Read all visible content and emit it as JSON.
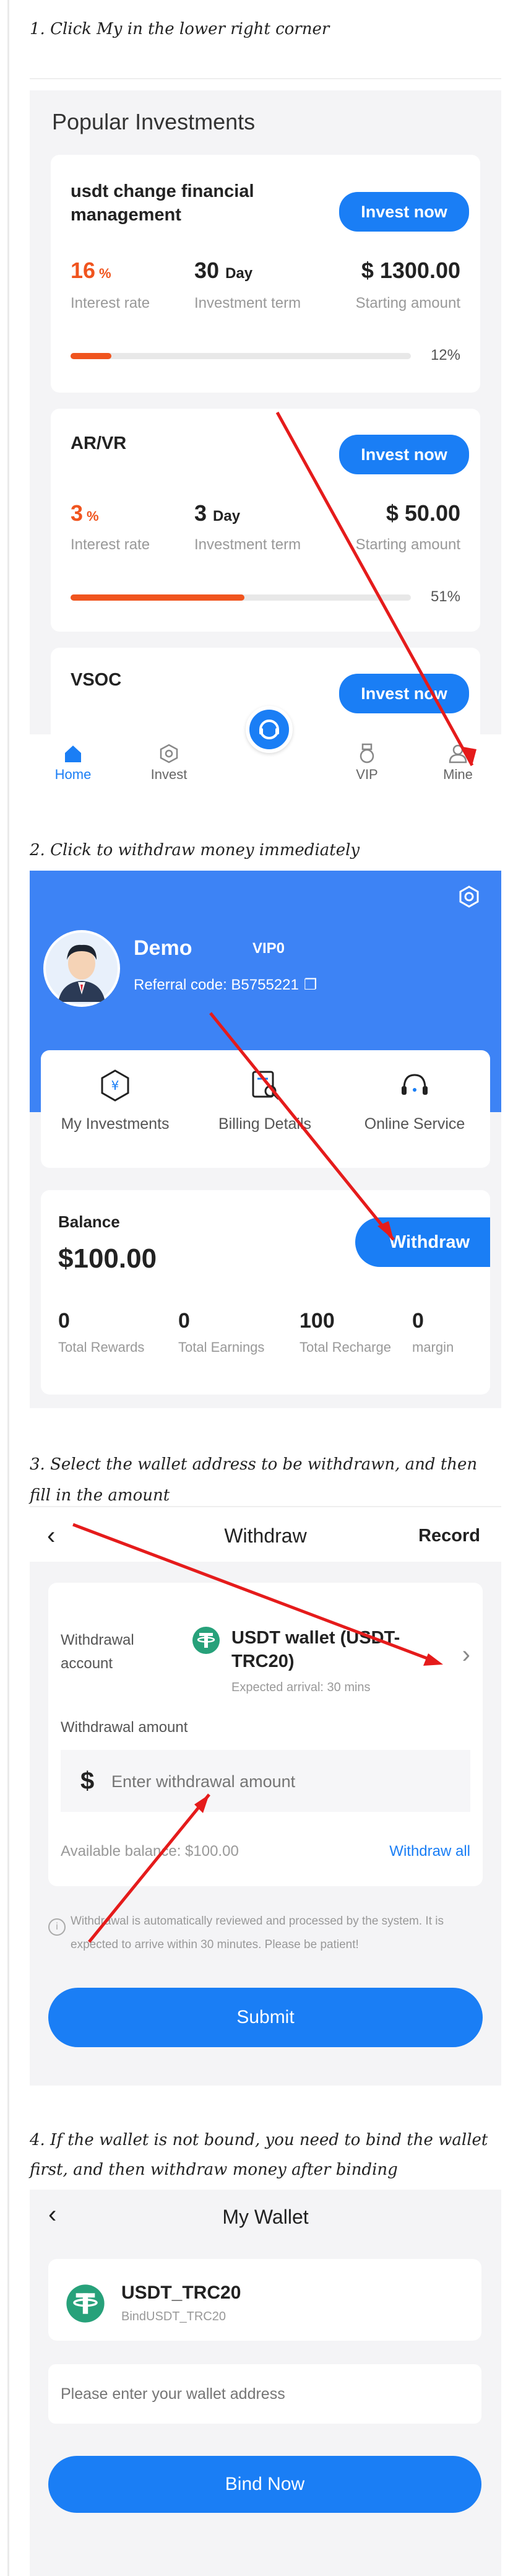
{
  "steps": {
    "s1": "1. Click My in the lower right corner",
    "s2": "2. Click to withdraw money immediately",
    "s3": "3. Select the wallet address to be withdrawn, and then fill in the amount",
    "s4": "4. If the wallet is not bound, you need to bind the wallet first, and then withdraw money after binding"
  },
  "invest": {
    "section_title": "Popular Investments",
    "items": [
      {
        "name": "usdt change financial management",
        "rate": "16",
        "pct": "%",
        "term": "30",
        "term_unit": "Day",
        "amount": "$ 1300.00",
        "progress": "12%",
        "button": "Invest now",
        "rate_label": "Interest rate",
        "term_label": "Investment term",
        "amount_label": "Starting amount"
      },
      {
        "name": "AR/VR",
        "rate": "3",
        "pct": "%",
        "term": "3",
        "term_unit": "Day",
        "amount": "$ 50.00",
        "progress": "51%",
        "button": "Invest now",
        "rate_label": "Interest rate",
        "term_label": "Investment term",
        "amount_label": "Starting amount"
      },
      {
        "name": "VSOC",
        "button": "Invest now"
      }
    ],
    "tabs": [
      "Home",
      "Invest",
      "VIP",
      "Mine"
    ],
    "colors": {
      "accent": "#1a7ef5",
      "rate": "#f0541e"
    }
  },
  "profile": {
    "name": "Demo",
    "vip": "VIP0",
    "referral": "Referral code:  B5755221",
    "menu": [
      "My Investments",
      "Billing Details",
      "Online Service"
    ],
    "balance_label": "Balance",
    "balance": "$100.00",
    "withdraw": "Withdraw",
    "stats": [
      {
        "value": "0",
        "label": "Total Rewards"
      },
      {
        "value": "0",
        "label": "Total Earnings"
      },
      {
        "value": "100",
        "label": "Total Recharge"
      },
      {
        "value": "0",
        "label": "margin"
      }
    ]
  },
  "withdraw": {
    "title": "Withdraw",
    "record": "Record",
    "account_label": "Withdrawal account",
    "wallet_name": "USDT wallet  (USDT-TRC20)",
    "arrival": "Expected arrival: 30 mins",
    "amount_label": "Withdrawal amount",
    "currency": "$",
    "amount_placeholder": "Enter withdrawal amount",
    "available": "Available balance:  $100.00",
    "withdraw_all": "Withdraw all",
    "notice": "Withdrawal is automatically reviewed and processed by the system. It is expected to arrive within 30 minutes. Please be patient!",
    "submit": "Submit"
  },
  "wallet": {
    "title": "My Wallet",
    "coin": "USDT_TRC20",
    "bind_sub": "BindUSDT_TRC20",
    "address_placeholder": "Please enter your wallet address",
    "bind": "Bind Now"
  }
}
